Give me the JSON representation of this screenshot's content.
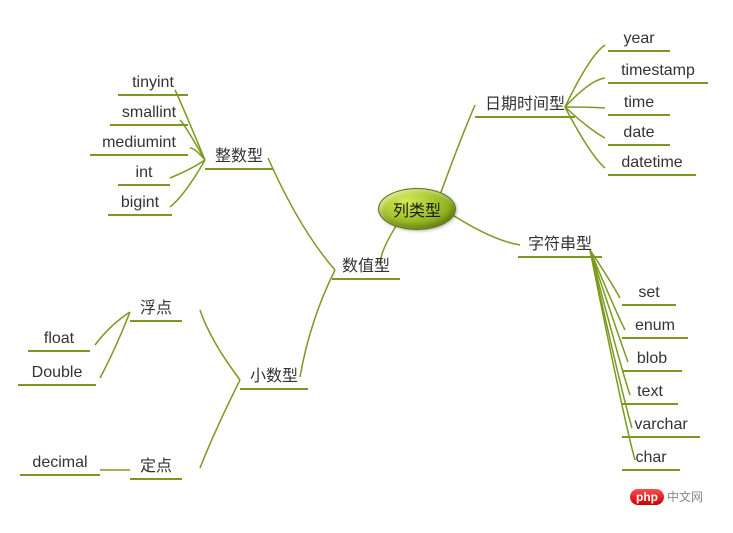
{
  "root": "列类型",
  "branches": {
    "numeric": "数值型",
    "integer": "整数型",
    "decimal_type": "小数型",
    "float_branch": "浮点",
    "fixed_branch": "定点",
    "datetime_branch": "日期时间型",
    "string_branch": "字符串型"
  },
  "leaves": {
    "int_types": [
      "tinyint",
      "smallint",
      "mediumint",
      "int",
      "bigint"
    ],
    "float_types": [
      "float",
      "Double"
    ],
    "fixed_types": [
      "decimal"
    ],
    "date_types": [
      "year",
      "timestamp",
      "time",
      "date",
      "datetime"
    ],
    "string_types": [
      "set",
      "enum",
      "blob",
      "text",
      "varchar",
      "char"
    ]
  },
  "watermark": {
    "badge": "php",
    "text": "中文网"
  }
}
